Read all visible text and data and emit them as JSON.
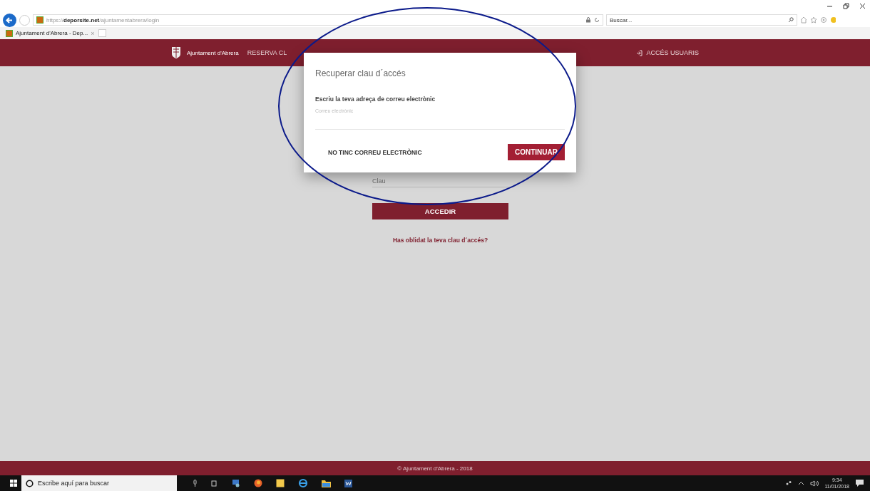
{
  "browser": {
    "url": "https://**deporsite.net**/ajuntamentabrera/login",
    "tab_title": "Ajuntament d'Abrera - Dep...",
    "tab_close": "×",
    "search_placeholder": "Buscar..."
  },
  "nav": {
    "brand": "Ajuntament d'Abrera",
    "items": [
      {
        "label": "RESERVA CL"
      }
    ],
    "user_link": "ACCÉS USUARIS"
  },
  "login": {
    "password_placeholder": "Clau",
    "submit": "ACCEDIR",
    "forgot_link": "Has oblidat la teva clau d´accés?"
  },
  "modal": {
    "title": "Recuperar clau d´accés",
    "prompt": "Escriu la teva adreça de correu electrònic",
    "email_placeholder": "Correu electrònic",
    "secondary_button": "NO TINC CORREU ELECTRÒNIC",
    "primary_button": "CONTINUAR"
  },
  "footer": "© Ajuntament d'Abrera - 2018",
  "taskbar": {
    "search_placeholder": "Escribe aquí para buscar",
    "time": "9:34",
    "date": "11/01/2018"
  }
}
